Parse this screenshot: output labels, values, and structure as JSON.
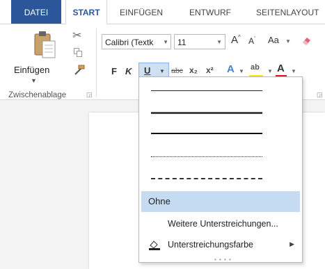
{
  "tabs": {
    "file": "DATEI",
    "start": "START",
    "insert": "EINFÜGEN",
    "design": "ENTWURF",
    "layout": "SEITENLAYOUT"
  },
  "clipboard": {
    "paste_label": "Einfügen",
    "group_label": "Zwischenablage"
  },
  "font": {
    "name": "Calibri (Textk",
    "size": "11",
    "case_label": "Aa",
    "bold": "F",
    "italic": "K",
    "underline": "U",
    "strike": "abc",
    "subscript": "x₂",
    "superscript": "x²",
    "highlight_label": "ab",
    "font_color_label": "A",
    "effects_label": "A",
    "highlight_color": "#ffec00",
    "font_color": "#e81123"
  },
  "underline_menu": {
    "none_label": "Ohne",
    "more_label": "Weitere Unterstreichungen...",
    "color_label": "Unterstreichungsfarbe"
  },
  "colors": {
    "accent": "#2b579a",
    "selection": "#c5dbf1"
  }
}
